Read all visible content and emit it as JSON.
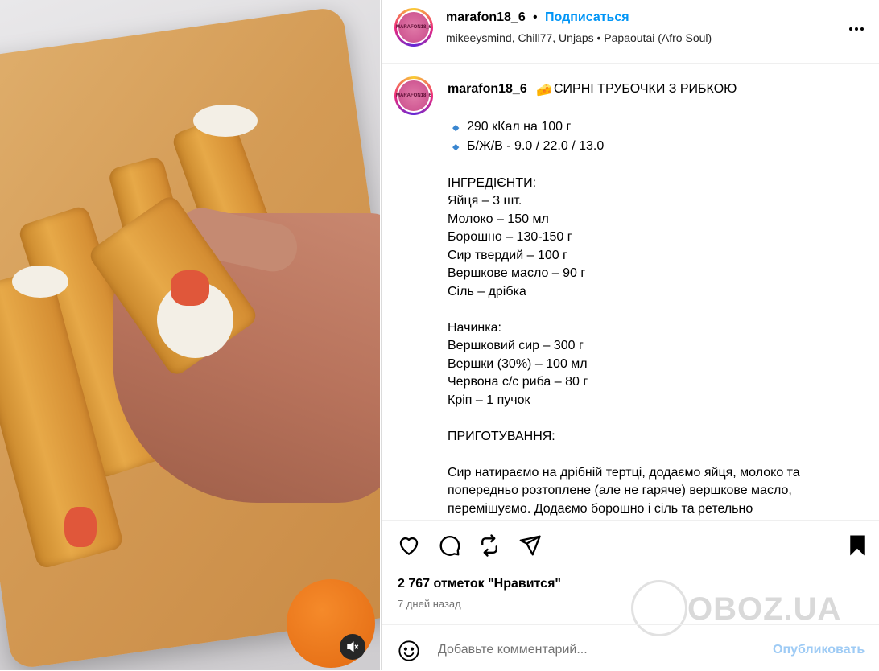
{
  "header": {
    "username": "marafon18_6",
    "separator": "•",
    "follow_label": "Подписаться",
    "audio_info": "mikeeysmind, Chill77, Unjaps • Papaoutai (Afro Soul)",
    "avatar_text": "MARAFON18_6",
    "more_icon": "more-options-icon"
  },
  "caption": {
    "username": "marafon18_6",
    "emoji": "🧀",
    "title": "СИРНІ ТРУБОЧКИ З РИБКОЮ",
    "bullet": "◆",
    "stats": [
      "290 кКал на 100 г",
      "Б/Ж/В - 9.0 / 22.0 / 13.0"
    ],
    "ingredients_title": "ІНГРЕДІЄНТИ:",
    "ingredients": [
      "Яйця – 3 шт.",
      "Молоко – 150 мл",
      "Борошно – 130-150 г",
      "Сир твердий – 100 г",
      "Вершкове масло – 90 г",
      "Сіль – дрібка"
    ],
    "filling_title": "Начинка:",
    "filling": [
      "Вершковий сир – 300 г",
      "Вершки (30%) – 100 мл",
      "Червона с/с риба – 80 г",
      "Кріп – 1 пучок"
    ],
    "method_title": "ПРИГОТУВАННЯ:",
    "method_text": "Сир натираємо на дрібній тертці, додаємо яйця, молоко та попередньо розтоплене (але не гаряче) вершкове масло, перемішуємо. Додаємо борошно і сіль та ретельно"
  },
  "actions": {
    "like_icon": "heart-icon",
    "comment_icon": "comment-icon",
    "repost_icon": "repost-icon",
    "share_icon": "share-icon",
    "save_icon": "bookmark-icon",
    "likes_text": "2 767 отметок \"Нравится\"",
    "time_text": "7 дней назад"
  },
  "watermark": "OBOZ.UA",
  "comment": {
    "placeholder": "Добавьте комментарий...",
    "publish_label": "Опубликовать"
  },
  "media": {
    "mute_icon": "muted-speaker-icon"
  }
}
